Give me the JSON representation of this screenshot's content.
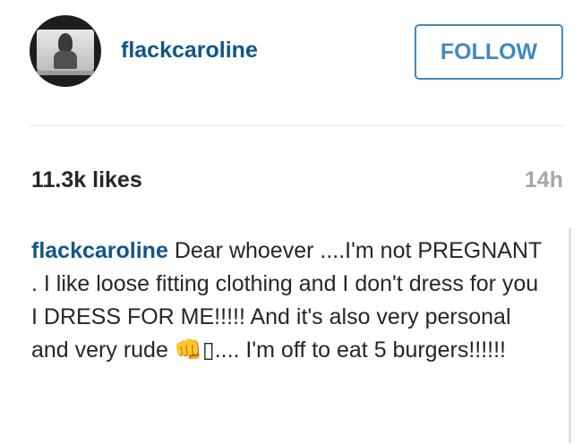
{
  "header": {
    "username": "flackcaroline",
    "follow_label": "FOLLOW"
  },
  "post": {
    "likes": "11.3k likes",
    "time_ago": "14h"
  },
  "caption": {
    "author": "flackcaroline",
    "text": "Dear whoever ....I'm not PREGNANT . I like loose fitting clothing and I don't dress for you I DRESS FOR ME!!!!! And it's also very personal and very rude 👊▯.... I'm off to eat 5 burgers!!!!!!"
  },
  "icons": {
    "avatar": "profile-photo-avatar"
  },
  "colors": {
    "link": "#125688",
    "follow_border": "#3f89c4",
    "muted": "#a5a7aa",
    "divider": "#e6e6e6"
  }
}
